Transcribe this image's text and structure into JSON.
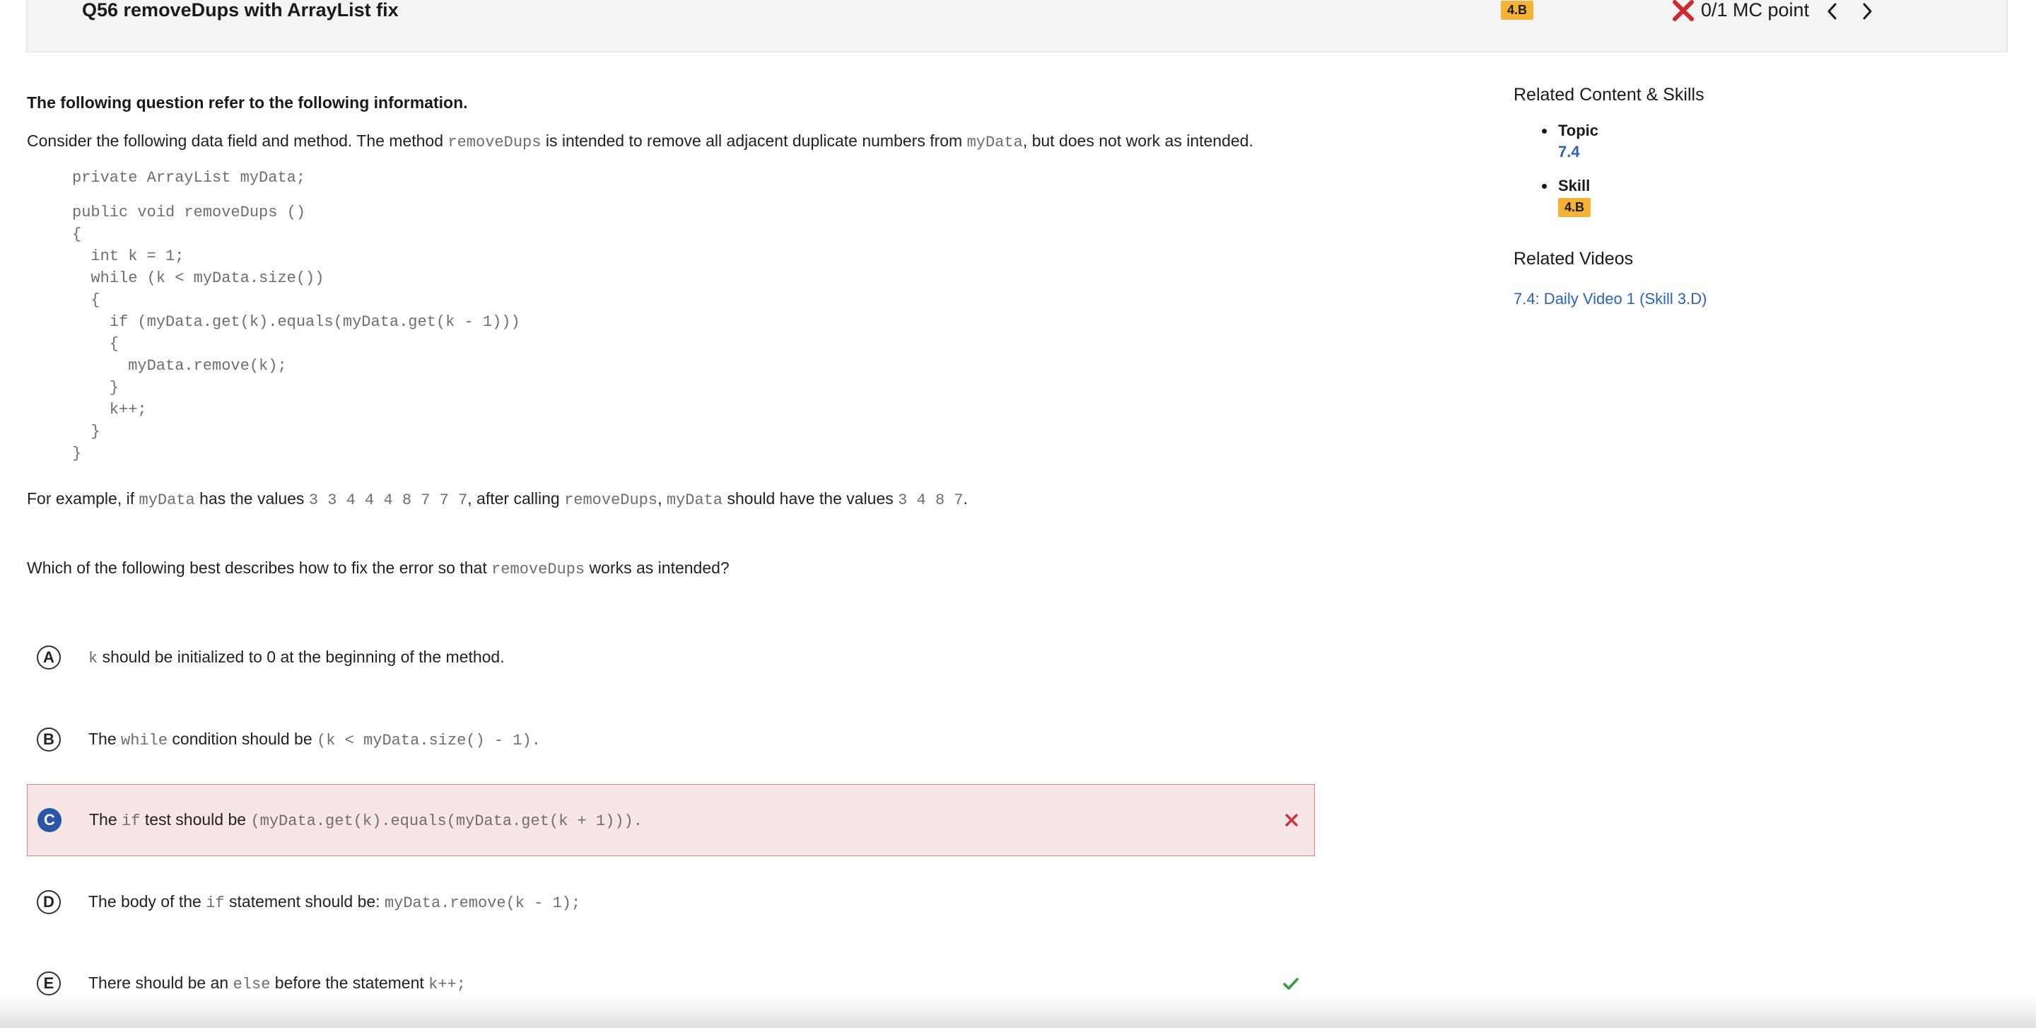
{
  "header": {
    "title": "Q56 removeDups with ArrayList fix",
    "skill_badge": "4.B",
    "score": "0/1 MC point"
  },
  "question": {
    "intro": "The following question refer to the following information.",
    "desc_pre": "Consider the following data field and method. The method ",
    "desc_code1": "removeDups",
    "desc_mid": " is intended to remove all adjacent duplicate numbers from ",
    "desc_code2": "myData",
    "desc_post": ", but does not work as intended.",
    "code_lines": [
      "private ArrayList myData;",
      "",
      "public void removeDups ()",
      "{",
      "  int k = 1;",
      "  while (k < myData.size())",
      "  {",
      "    if (myData.get(k).equals(myData.get(k - 1)))",
      "    {",
      "      myData.remove(k);",
      "    }",
      "    k++;",
      "  }",
      "}"
    ],
    "example_pre": "For example, if ",
    "example_code1": "myData",
    "example_mid1": " has the values ",
    "example_code2": "3 3 4 4 4 8 7 7 7",
    "example_mid2": ", after calling ",
    "example_code3": "removeDups",
    "example_mid3": ", ",
    "example_code4": "myData",
    "example_mid4": " should have the values ",
    "example_code5": "3 4 8 7",
    "example_post": ".",
    "prompt_pre": "Which of the following best describes how to fix the error so that ",
    "prompt_code": "removeDups",
    "prompt_post": " works as intended?"
  },
  "options": {
    "A": {
      "letter": "A",
      "code1": "k",
      "text1": " should be initialized to 0 at the beginning of the method."
    },
    "B": {
      "letter": "B",
      "text1": "The ",
      "code1": "while",
      "text2": " condition should be ",
      "code2": "(k < myData.size() - 1)."
    },
    "C": {
      "letter": "C",
      "text1": "The ",
      "code1": "if",
      "text2": " test should be ",
      "code2": "(myData.get(k).equals(myData.get(k + 1)))."
    },
    "D": {
      "letter": "D",
      "text1": "The body of the ",
      "code1": "if",
      "text2": " statement should be: ",
      "code2": "myData.remove(k - 1);"
    },
    "E": {
      "letter": "E",
      "text1": "There should be an ",
      "code1": "else",
      "text2": " before the statement ",
      "code2": "k++;"
    }
  },
  "sidebar": {
    "related_title": "Related Content & Skills",
    "topic_label": "Topic",
    "topic_value": "7.4",
    "skill_label": "Skill",
    "skill_value": "4.B",
    "videos_title": "Related Videos",
    "video_link": "7.4: Daily Video 1 (Skill 3.D)"
  },
  "colors": {
    "badge": "#f5b335",
    "wrong_bg": "#f7e6e6",
    "wrong_border": "#e08080",
    "selected_option": "#2a56a8",
    "link": "#2a63b8",
    "incorrect_mark": "#c8323c",
    "correct_mark": "#3a9a3a"
  },
  "icons": {
    "score": "x-icon",
    "prev": "chevron-left-icon",
    "next": "chevron-right-icon",
    "wrong_answer": "close-icon",
    "right_answer": "check-icon"
  }
}
